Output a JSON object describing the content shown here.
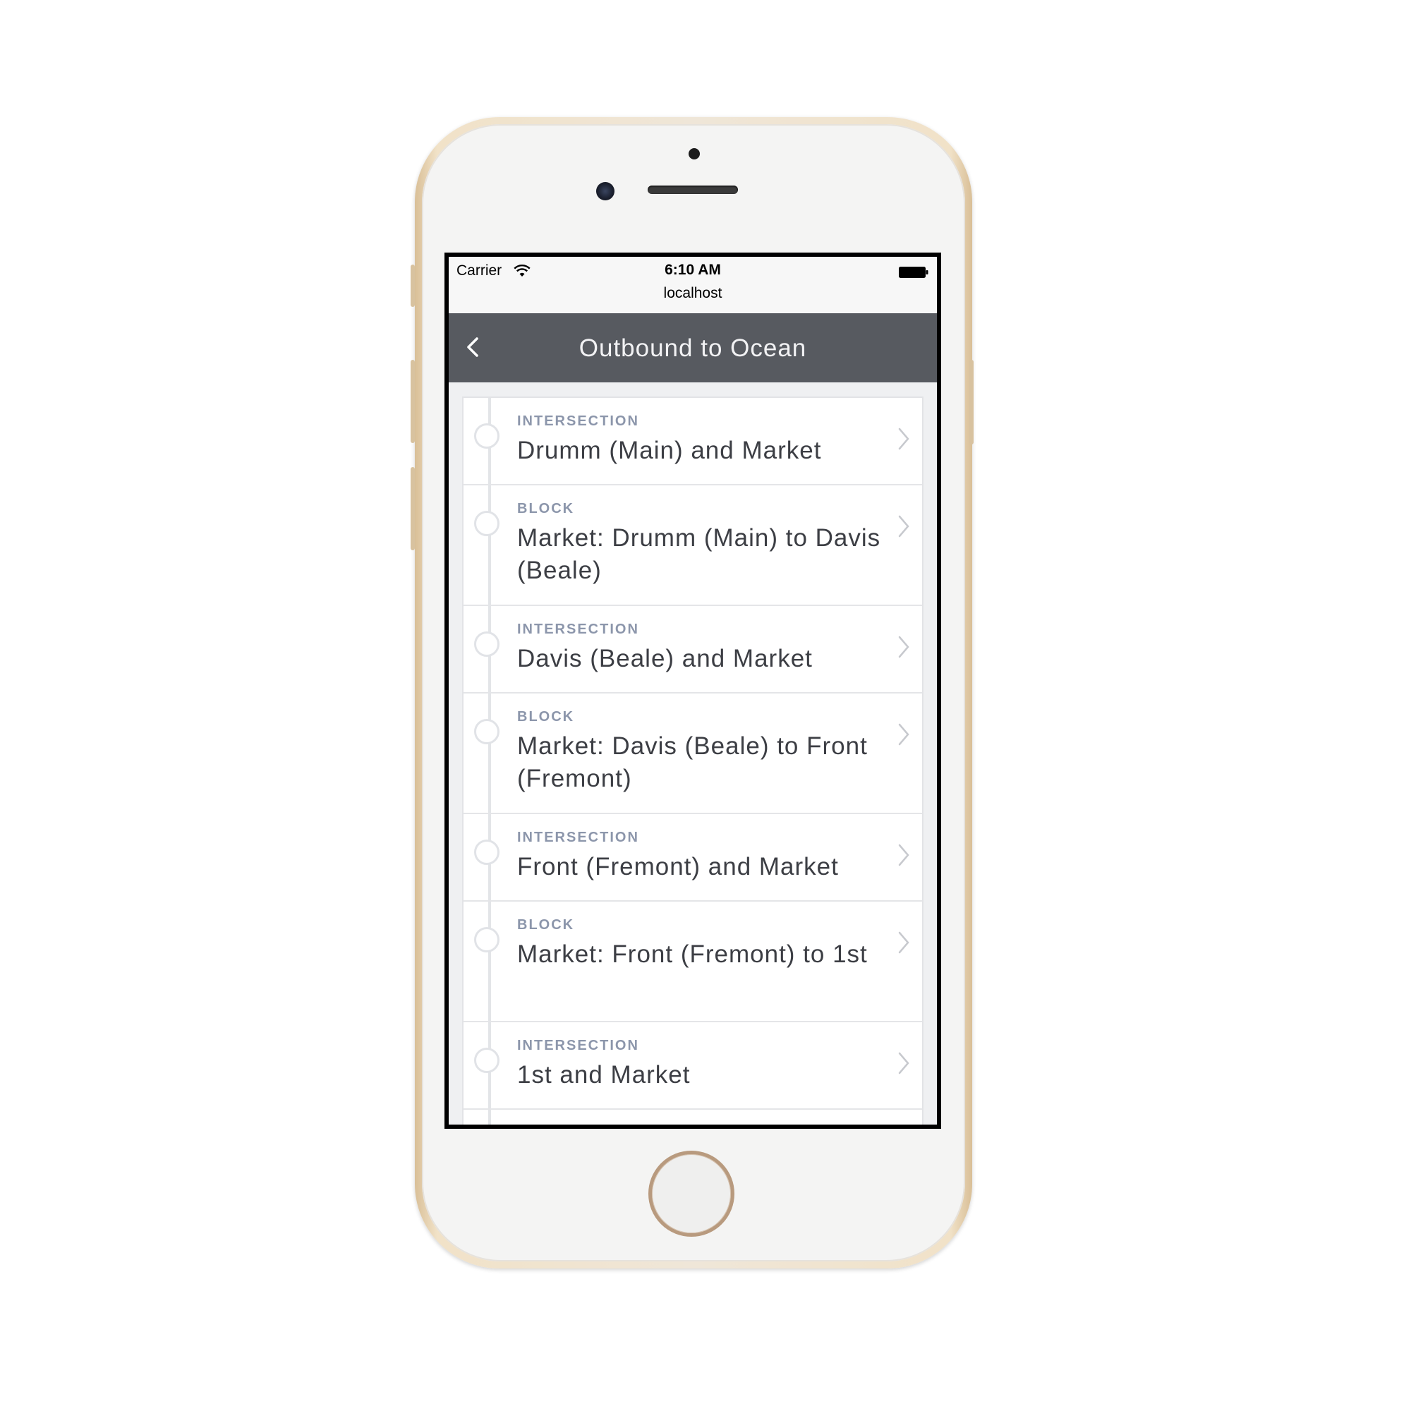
{
  "status_bar": {
    "carrier": "Carrier",
    "time": "6:10 AM",
    "url": "localhost"
  },
  "nav": {
    "title": "Outbound to Ocean",
    "back_icon": "chevron-left-icon"
  },
  "stops": [
    {
      "kind": "INTERSECTION",
      "name": "Drumm (Main) and Market"
    },
    {
      "kind": "BLOCK",
      "name": "Market: Drumm (Main) to Davis (Beale)"
    },
    {
      "kind": "INTERSECTION",
      "name": "Davis (Beale) and Market"
    },
    {
      "kind": "BLOCK",
      "name": "Market: Davis (Beale) to Front (Fremont)"
    },
    {
      "kind": "INTERSECTION",
      "name": "Front (Fremont) and Market"
    },
    {
      "kind": "BLOCK",
      "name": "Market: Front (Fremont) to 1st"
    },
    {
      "kind": "INTERSECTION",
      "name": "1st and Market"
    }
  ],
  "colors": {
    "nav_background": "#575a60",
    "kind_label": "#8c96ab",
    "item_text": "#3c3e44",
    "phone_gold": "#e8d2b0"
  }
}
